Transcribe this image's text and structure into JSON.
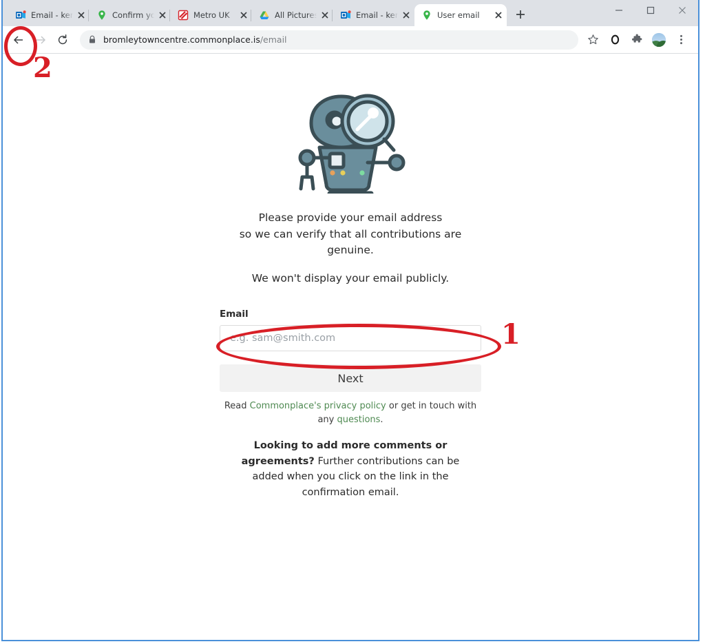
{
  "browser": {
    "tabs": [
      {
        "title": "Email - kerry ho",
        "favicon": "outlook-icon",
        "active": false
      },
      {
        "title": "Confirm your e",
        "favicon": "commonplace-pin-icon",
        "active": false
      },
      {
        "title": "Metro UK",
        "favicon": "metro-icon",
        "active": false
      },
      {
        "title": "All Pictures By",
        "favicon": "google-drive-icon",
        "active": false
      },
      {
        "title": "Email - kerry ho",
        "favicon": "outlook-icon",
        "active": false
      },
      {
        "title": "User email",
        "favicon": "commonplace-pin-icon",
        "active": true
      }
    ],
    "new_tab_label": "+",
    "window_controls": {
      "minimize": "minimize-icon",
      "maximize": "maximize-icon",
      "close": "close-icon"
    },
    "toolbar": {
      "back": "back-arrow-icon",
      "forward": "forward-arrow-icon",
      "reload": "reload-icon",
      "lock": "lock-icon",
      "url_domain": "bromleytowncentre.commonplace.is",
      "url_path": "/email",
      "bookmark": "star-icon",
      "opera_circle": "circle-icon",
      "extensions": "puzzle-piece-icon",
      "profile": "avatar-icon",
      "menu": "three-dot-menu-icon"
    }
  },
  "page": {
    "illustration": "robot-with-magnifier-icon",
    "intro_line_1": "Please provide your email address",
    "intro_line_2": "so we can verify that all contributions are",
    "intro_line_3": "genuine.",
    "intro_line_4": "We won't display your email publicly.",
    "form": {
      "email_label": "Email",
      "email_value": "",
      "email_placeholder": "e.g. sam@smith.com",
      "next_label": "Next"
    },
    "legal": {
      "prefix": "Read ",
      "privacy_link": "Commonplace's privacy policy",
      "middle": " or get in touch with any ",
      "questions_link": "questions",
      "suffix": "."
    },
    "note": {
      "bold": "Looking to add more comments or agreements?",
      "rest": " Further contributions can be added when you click on the link in the confirmation email."
    }
  },
  "annotations": {
    "marker_1": "1",
    "marker_2": "2",
    "color": "#d81f26"
  }
}
